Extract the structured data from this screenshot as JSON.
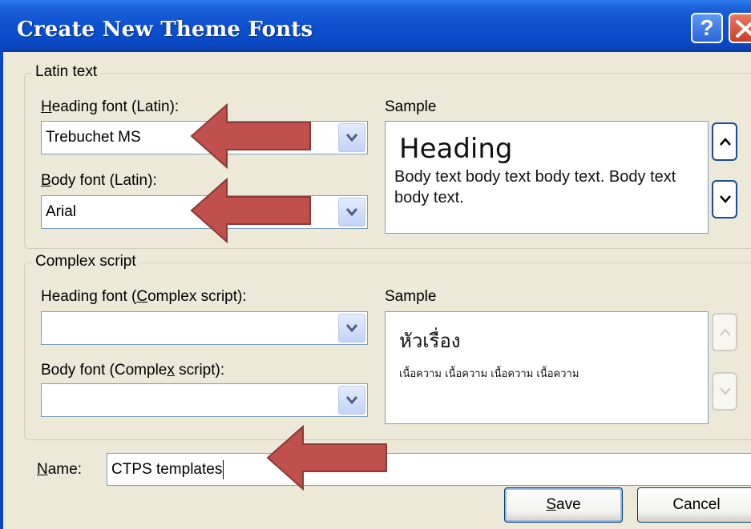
{
  "window": {
    "title": "Create New Theme Fonts",
    "help_icon": "help-icon",
    "close_icon": "close-icon"
  },
  "latin": {
    "legend": "Latin text",
    "heading_label_access": "H",
    "heading_label_rest": "eading font (Latin):",
    "heading_value": "Trebuchet MS",
    "body_label_access": "B",
    "body_label_rest": "ody font (Latin):",
    "body_value": "Arial",
    "sample_label": "Sample",
    "sample_heading": "Heading",
    "sample_body": "Body text body text body text. Body text body text."
  },
  "complex": {
    "legend": "Complex script",
    "heading_label_pre": "Heading font (",
    "heading_label_access": "C",
    "heading_label_post": "omplex script):",
    "heading_value": "",
    "body_label_pre": "Body font (Comple",
    "body_label_access": "x",
    "body_label_post": " script):",
    "body_value": "",
    "sample_label": "Sample",
    "sample_heading": "หัวเรื่อง",
    "sample_body": "เนื้อความ เนื้อความ เนื้อความ เนื้อความ"
  },
  "name": {
    "label_access": "N",
    "label_rest": "ame:",
    "value": "CTPS templates"
  },
  "buttons": {
    "save_access": "S",
    "save_rest": "ave",
    "cancel": "Cancel"
  },
  "colors": {
    "titlebar": "#0c50d0",
    "dialog_bg": "#ece9d8",
    "annotation_arrow": "#c0504d"
  }
}
